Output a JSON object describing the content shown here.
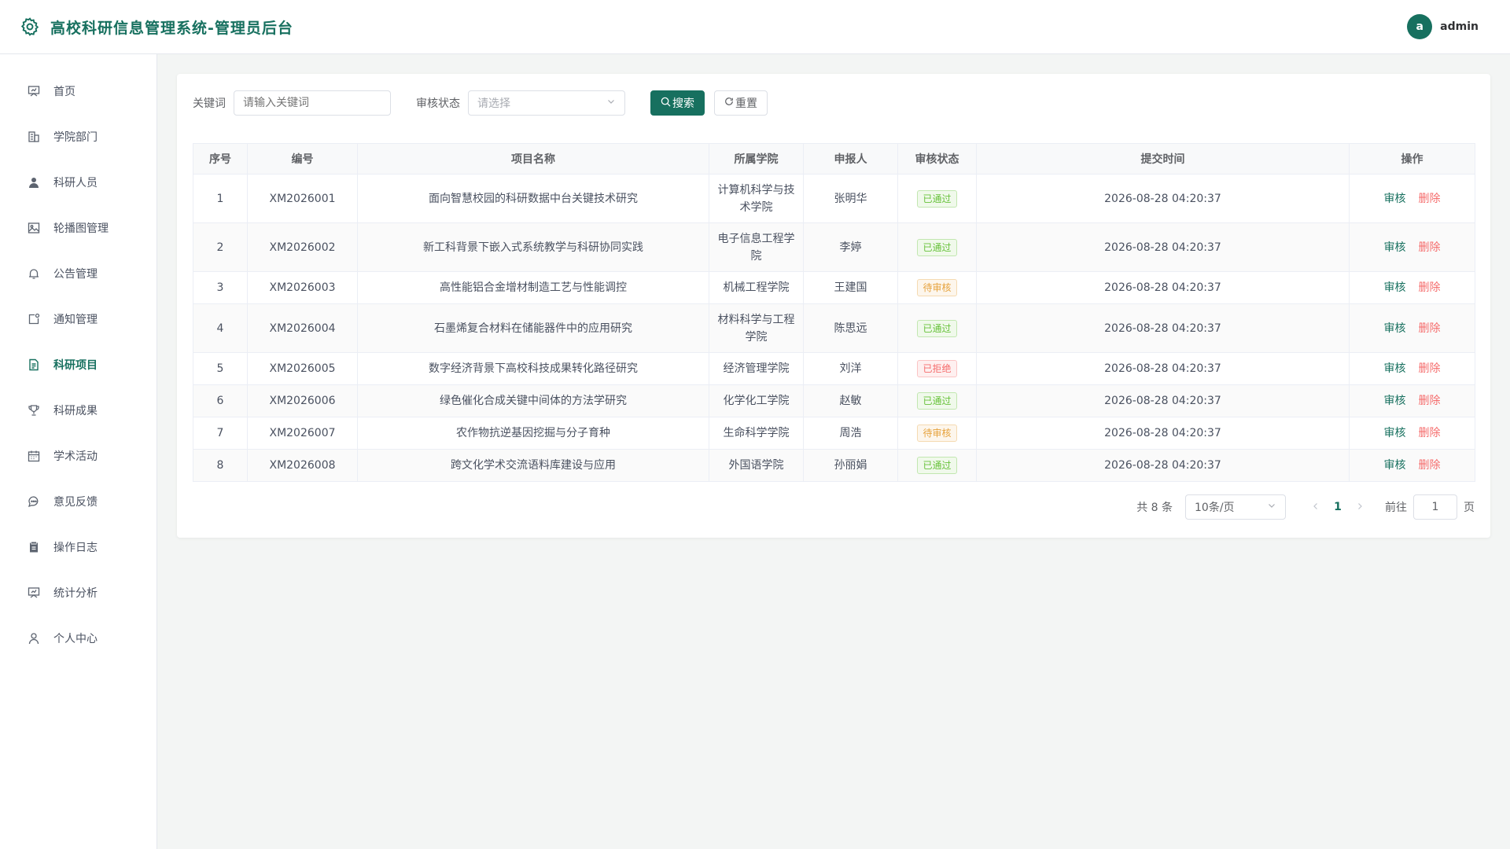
{
  "header": {
    "title": "高校科研信息管理系统-管理员后台",
    "avatar_letter": "a",
    "username": "admin"
  },
  "sidebar": {
    "items": [
      {
        "label": "首页",
        "icon": "dashboard-icon"
      },
      {
        "label": "学院部门",
        "icon": "building-icon"
      },
      {
        "label": "科研人员",
        "icon": "user-icon"
      },
      {
        "label": "轮播图管理",
        "icon": "picture-icon"
      },
      {
        "label": "公告管理",
        "icon": "bell-icon"
      },
      {
        "label": "通知管理",
        "icon": "notification-icon"
      },
      {
        "label": "科研项目",
        "icon": "document-icon",
        "active": true
      },
      {
        "label": "科研成果",
        "icon": "trophy-icon"
      },
      {
        "label": "学术活动",
        "icon": "calendar-icon"
      },
      {
        "label": "意见反馈",
        "icon": "chat-icon"
      },
      {
        "label": "操作日志",
        "icon": "clipboard-icon"
      },
      {
        "label": "统计分析",
        "icon": "chart-icon"
      },
      {
        "label": "个人中心",
        "icon": "person-icon"
      }
    ]
  },
  "filters": {
    "keyword_label": "关键词",
    "keyword_placeholder": "请输入关键词",
    "status_label": "审核状态",
    "status_placeholder": "请选择",
    "search_label": "搜索",
    "reset_label": "重置"
  },
  "table": {
    "headers": [
      "序号",
      "编号",
      "项目名称",
      "所属学院",
      "申报人",
      "审核状态",
      "提交时间",
      "操作"
    ],
    "actions": {
      "review": "审核",
      "delete": "删除"
    },
    "rows": [
      {
        "no": "1",
        "code": "XM2026001",
        "name": "面向智慧校园的科研数据中台关键技术研究",
        "college": "计算机科学与技术学院",
        "applicant": "张明华",
        "status": "已通过",
        "status_type": "ok",
        "time": "2026-08-28 04:20:37"
      },
      {
        "no": "2",
        "code": "XM2026002",
        "name": "新工科背景下嵌入式系统教学与科研协同实践",
        "college": "电子信息工程学院",
        "applicant": "李婷",
        "status": "已通过",
        "status_type": "ok",
        "time": "2026-08-28 04:20:37"
      },
      {
        "no": "3",
        "code": "XM2026003",
        "name": "高性能铝合金增材制造工艺与性能调控",
        "college": "机械工程学院",
        "applicant": "王建国",
        "status": "待审核",
        "status_type": "wait",
        "time": "2026-08-28 04:20:37"
      },
      {
        "no": "4",
        "code": "XM2026004",
        "name": "石墨烯复合材料在储能器件中的应用研究",
        "college": "材料科学与工程学院",
        "applicant": "陈思远",
        "status": "已通过",
        "status_type": "ok",
        "time": "2026-08-28 04:20:37"
      },
      {
        "no": "5",
        "code": "XM2026005",
        "name": "数字经济背景下高校科技成果转化路径研究",
        "college": "经济管理学院",
        "applicant": "刘洋",
        "status": "已拒绝",
        "status_type": "rej",
        "time": "2026-08-28 04:20:37"
      },
      {
        "no": "6",
        "code": "XM2026006",
        "name": "绿色催化合成关键中间体的方法学研究",
        "college": "化学化工学院",
        "applicant": "赵敏",
        "status": "已通过",
        "status_type": "ok",
        "time": "2026-08-28 04:20:37"
      },
      {
        "no": "7",
        "code": "XM2026007",
        "name": "农作物抗逆基因挖掘与分子育种",
        "college": "生命科学学院",
        "applicant": "周浩",
        "status": "待审核",
        "status_type": "wait",
        "time": "2026-08-28 04:20:37"
      },
      {
        "no": "8",
        "code": "XM2026008",
        "name": "跨文化学术交流语料库建设与应用",
        "college": "外国语学院",
        "applicant": "孙丽娟",
        "status": "已通过",
        "status_type": "ok",
        "time": "2026-08-28 04:20:37"
      }
    ]
  },
  "pagination": {
    "total_text": "共 8 条",
    "page_size": "10条/页",
    "current_page": "1",
    "goto_label": "前往",
    "goto_value": "1",
    "page_suffix": "页"
  },
  "colors": {
    "primary": "#17705f",
    "danger": "#f56c6c",
    "success": "#67c23a",
    "warning": "#e6a23c"
  }
}
